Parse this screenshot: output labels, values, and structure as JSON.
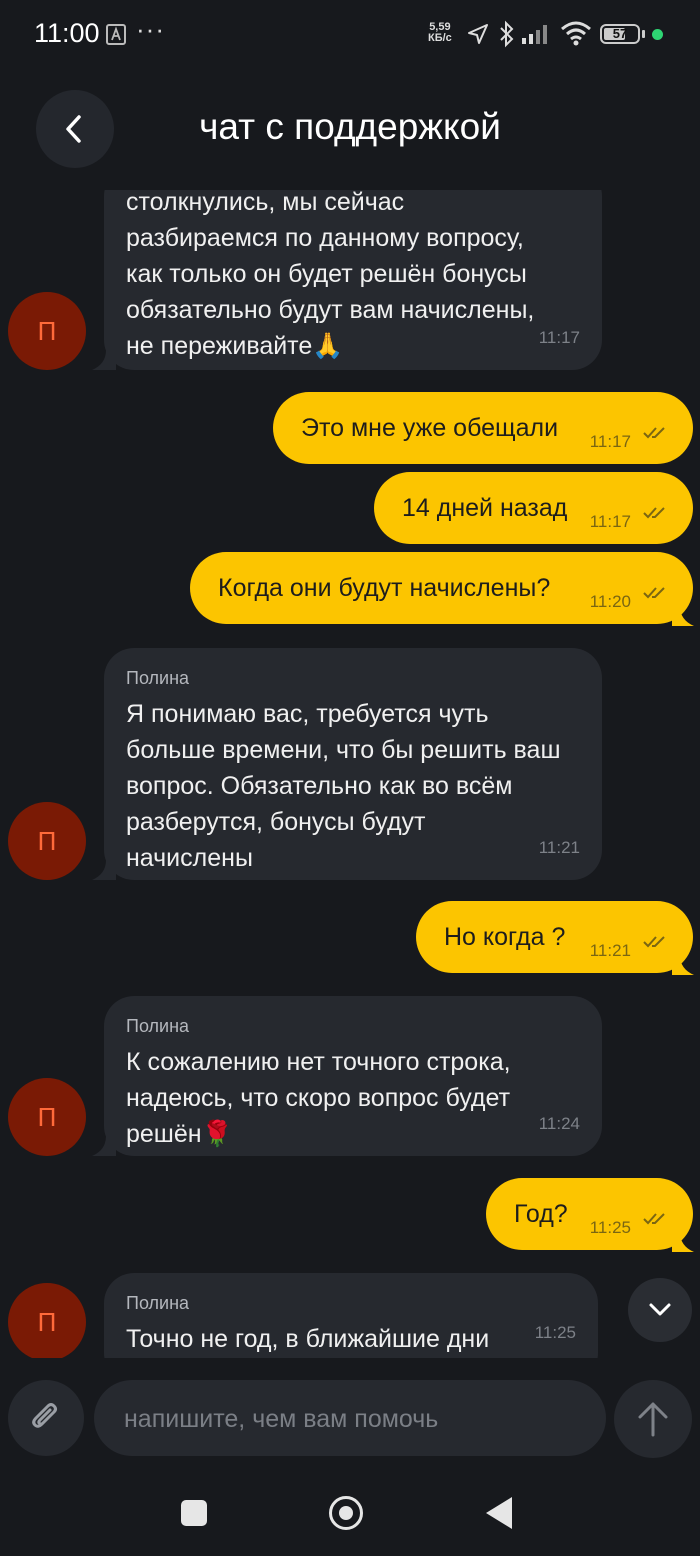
{
  "status_bar": {
    "time": "11:00",
    "dots": "···",
    "net_speed_value": "5,59",
    "net_speed_unit": "КБ/с",
    "battery": "57"
  },
  "header": {
    "title": "чат с поддержкой"
  },
  "messages": [
    {
      "lines": [
        "столкнулись, мы сейчас",
        "разбираемся по данному вопросу,",
        "как только он будет решён бонусы",
        "обязательно будут вам начислены,",
        "не переживайте🙏"
      ],
      "time": "11:17",
      "avatar": "П"
    },
    {
      "text": "Это мне уже обещали",
      "time": "11:17"
    },
    {
      "text": "14 дней назад",
      "time": "11:17"
    },
    {
      "text": "Когда они будут начислены?",
      "time": "11:20"
    },
    {
      "sender": "Полина",
      "lines": [
        "Я понимаю вас, требуется чуть",
        "больше времени, что бы решить ваш",
        "вопрос. Обязательно как во всём",
        "разберутся, бонусы будут",
        "начислены"
      ],
      "time": "11:21",
      "avatar": "П"
    },
    {
      "text": "Но когда ?",
      "time": "11:21"
    },
    {
      "sender": "Полина",
      "lines": [
        "К сожалению нет точного строка,",
        "надеюсь, что скоро вопрос будет",
        "решён🌹"
      ],
      "time": "11:24",
      "avatar": "П"
    },
    {
      "text": "Год?",
      "time": "11:25"
    },
    {
      "sender": "Полина",
      "lines": [
        "Точно не год, в ближайшие дни"
      ],
      "time": "11:25",
      "avatar": "П"
    }
  ],
  "composer": {
    "placeholder": "напишите, чем вам помочь"
  },
  "colors": {
    "background": "#17191d",
    "incoming_bubble": "#26292f",
    "outgoing_bubble": "#fcc500",
    "avatar_bg": "#7a1a05",
    "avatar_text": "#ff6a3a"
  },
  "icons": [
    "back-icon",
    "chevron-down-icon",
    "paperclip-icon",
    "send-arrow-icon",
    "double-check-icon"
  ]
}
